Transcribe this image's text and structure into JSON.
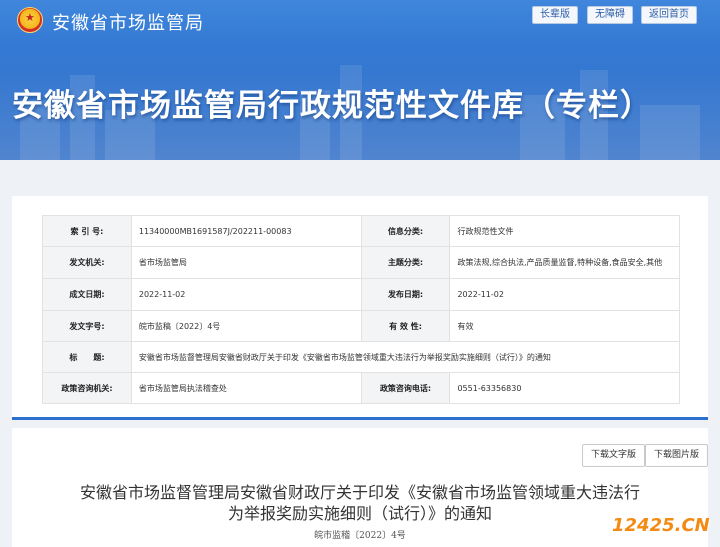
{
  "header": {
    "site_name": "安徽省市场监管局",
    "buttons": [
      "长辈版",
      "无障碍",
      "返回首页"
    ]
  },
  "banner": {
    "title": "安徽省市场监管局行政规范性文件库（专栏）"
  },
  "info_table": {
    "rows": [
      {
        "l1": "索 引 号:",
        "v1": "11340000MB1691587J/202211-00083",
        "l2": "信息分类:",
        "v2": "行政规范性文件"
      },
      {
        "l1": "发文机关:",
        "v1": "省市场监管局",
        "l2": "主题分类:",
        "v2": "政策法规,综合执法,产品质量监督,特种设备,食品安全,其他"
      },
      {
        "l1": "成文日期:",
        "v1": "2022-11-02",
        "l2": "发布日期:",
        "v2": "2022-11-02"
      },
      {
        "l1": "发文字号:",
        "v1": "皖市监稿〔2022〕4号",
        "l2": "有 效 性:",
        "v2": "有效"
      }
    ],
    "title_label": "标　　题:",
    "title_value": "安徽省市场监督管理局安徽省财政厅关于印发《安徽省市场监管领域重大违法行为举报奖励实施细则（试行）》的通知",
    "last_row": {
      "l1": "政策咨询机关:",
      "v1": "省市场监管局执法稽查处",
      "l2": "政策咨询电话:",
      "v2": "0551-63356830"
    }
  },
  "content": {
    "download_text": "下载文字版",
    "download_image": "下载图片版",
    "doc_title_line1": "安徽省市场监督管理局安徽省财政厅关于印发《安徽省市场监管领域重大违法行",
    "doc_title_line2": "为举报奖励实施细则（试行）》的通知",
    "doc_number": "皖市监稽〔2022〕4号"
  },
  "watermark": "12425.CN",
  "colors": {
    "banner": "#2e73cf",
    "accent": "#2c6fce",
    "watermark": "#f28a13"
  }
}
